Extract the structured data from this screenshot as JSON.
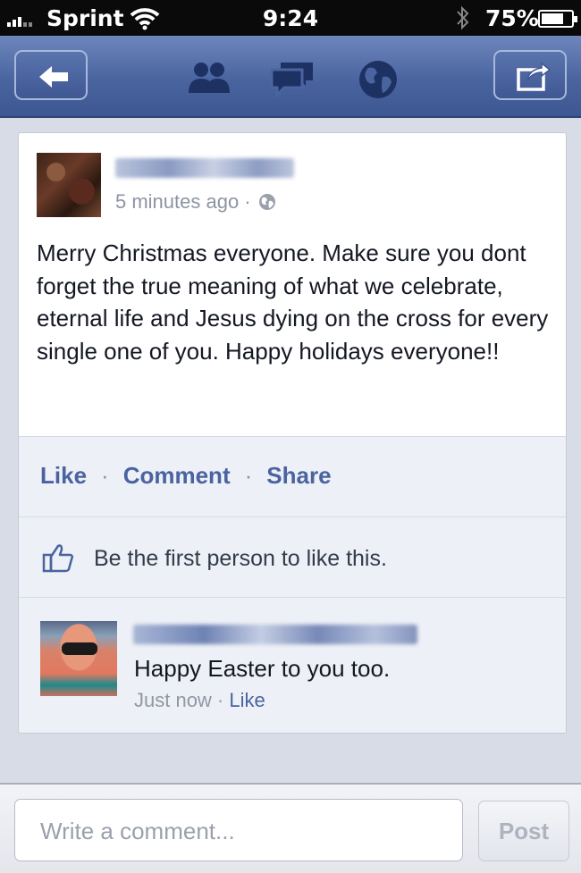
{
  "status_bar": {
    "carrier": "Sprint",
    "time": "9:24",
    "battery_percent": "75%",
    "battery_level": 0.75,
    "signal_bars": 3,
    "icons": [
      "wifi-icon",
      "bluetooth-icon",
      "battery-icon"
    ]
  },
  "nav_bar": {
    "icons": [
      "back-arrow-icon",
      "friends-icon",
      "messages-icon",
      "globe-icon",
      "share-icon"
    ]
  },
  "post": {
    "time_ago": "5 minutes ago ·",
    "text": "Merry Christmas everyone. Make sure you dont forget the true meaning of what we celebrate, eternal life and Jesus dying on the cross for every single one of you. Happy holidays everyone!!",
    "actions": {
      "like": "Like",
      "comment": "Comment",
      "share": "Share",
      "separator": "·"
    },
    "likes_text": "Be the first person to like this."
  },
  "comment": {
    "text": "Happy Easter to you too.",
    "time": "Just now · ",
    "like": "Like"
  },
  "composer": {
    "placeholder": "Write a comment...",
    "post_label": "Post"
  },
  "colors": {
    "nav_blue": "#4a64a0",
    "link_blue": "#4a63a0",
    "card_bg": "#ffffff",
    "ufi_bg": "#edf0f6"
  }
}
